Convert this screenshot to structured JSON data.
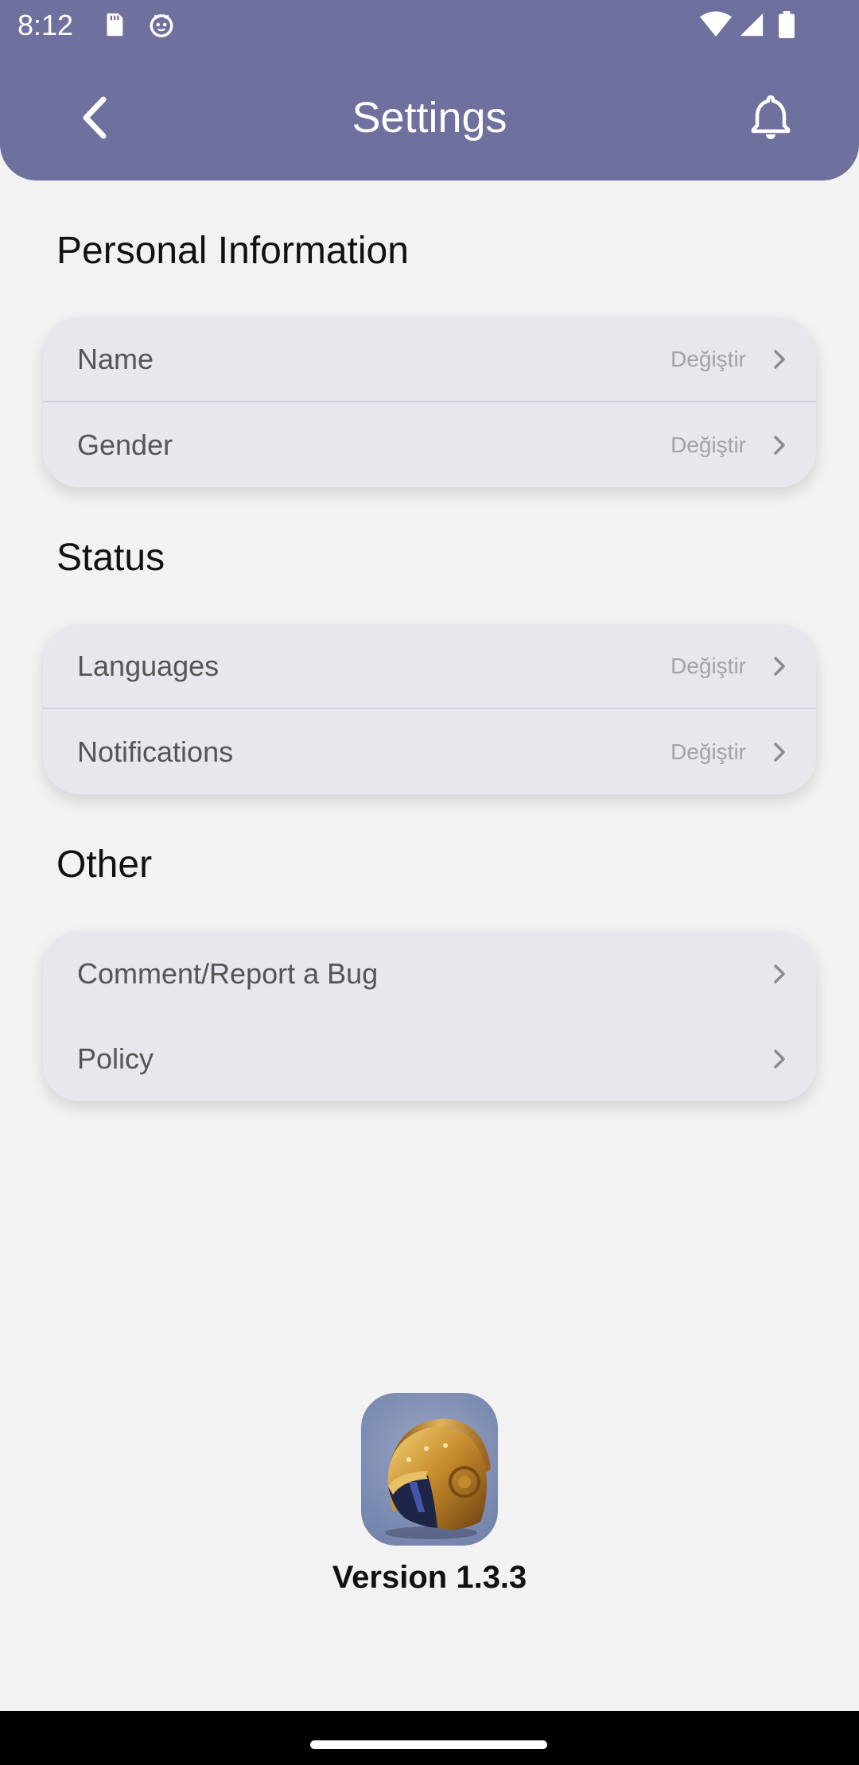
{
  "status_bar": {
    "time": "8:12",
    "icons": [
      "sd-card-icon",
      "cat-face-icon",
      "wifi-icon",
      "cellular-signal-icon",
      "battery-icon"
    ]
  },
  "app_bar": {
    "title": "Settings",
    "back_icon": "chevron-left-icon",
    "bell_icon": "bell-icon",
    "color": "#70709e"
  },
  "sections": [
    {
      "title": "Personal Information",
      "items": [
        {
          "label": "Name",
          "action": "Değiştir"
        },
        {
          "label": "Gender",
          "action": "Değiştir"
        }
      ]
    },
    {
      "title": "Status",
      "items": [
        {
          "label": "Languages",
          "action": "Değiştir"
        },
        {
          "label": "Notifications",
          "action": "Değiştir"
        }
      ]
    },
    {
      "title": "Other",
      "items": [
        {
          "label": "Comment/Report a Bug"
        },
        {
          "label": "Policy"
        }
      ]
    }
  ],
  "footer": {
    "logo_icon": "golden-helmet-logo",
    "version": "Version 1.3.3"
  },
  "colors": {
    "background": "#f2f2f2",
    "card": "#e8e7ee",
    "accent": "#70709e"
  }
}
